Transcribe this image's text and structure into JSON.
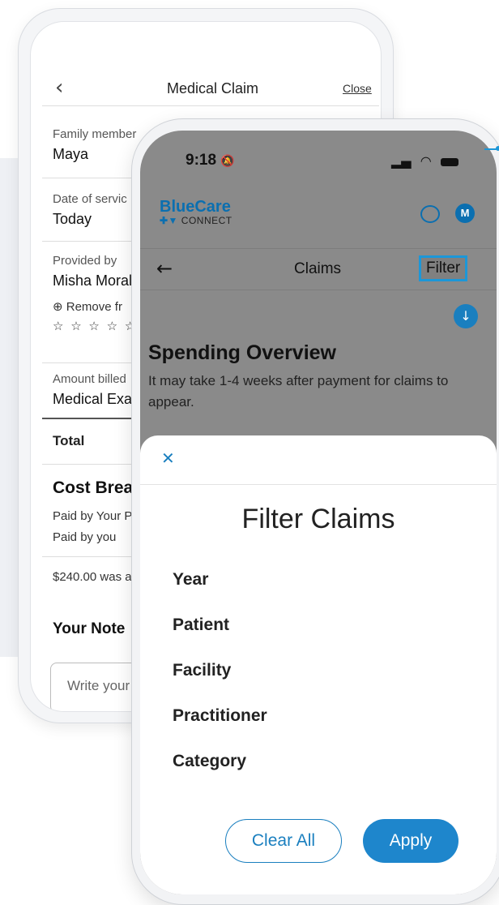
{
  "back_screen": {
    "header": {
      "title": "Medical Claim",
      "close_label": "Close"
    },
    "family_member": {
      "label": "Family member",
      "value": "Maya"
    },
    "date_of_service": {
      "label": "Date of servic",
      "value": "Today"
    },
    "provided_by": {
      "label": "Provided by",
      "value": "Misha Moral"
    },
    "remove_label": "Remove fr",
    "stars": "☆ ☆ ☆ ☆ ☆",
    "amount_billed": {
      "label": "Amount billed",
      "value": "Medical Exa"
    },
    "total_label": "Total",
    "cost_breakdown": {
      "title": "Cost Brea",
      "paid_by_plan": "Paid by Your P",
      "paid_by_you": "Paid by you",
      "note_line": "$240.00 was a"
    },
    "your_notes": {
      "title": "Your Note",
      "placeholder": "Write your"
    }
  },
  "front_screen": {
    "status_bar": {
      "time": "9:18",
      "bell_icon": "bell-slash-icon"
    },
    "brand": {
      "name": "BlueCare",
      "sub": "CONNECT"
    },
    "avatar_letter": "M",
    "nav": {
      "title": "Claims",
      "filter_label": "Filter"
    },
    "overview": {
      "title": "Spending Overview",
      "text": "It may take 1-4 weeks after payment for claims to appear."
    },
    "filter_sheet": {
      "title": "Filter Claims",
      "items": [
        "Year",
        "Patient",
        "Facility",
        "Practitioner",
        "Category"
      ],
      "clear_label": "Clear All",
      "apply_label": "Apply"
    }
  },
  "colors": {
    "accent": "#1c97d8",
    "brand_blue": "#0b6fb0",
    "apply_button": "#1e86cc",
    "overlay": "#8a8a8a"
  }
}
